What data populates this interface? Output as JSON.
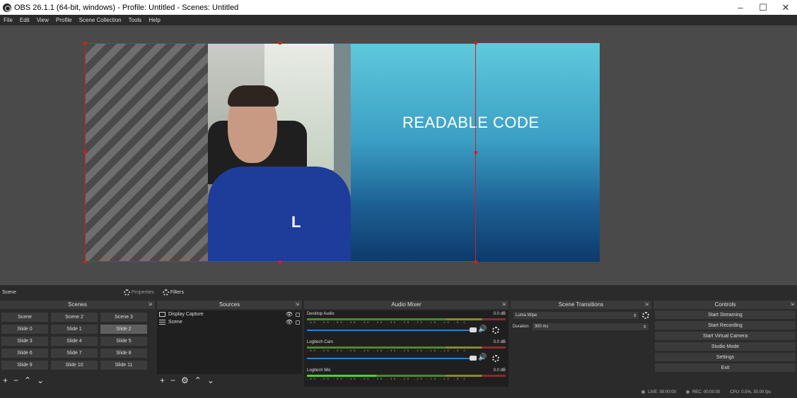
{
  "window": {
    "title": "OBS 26.1.1 (64-bit, windows) - Profile: Untitled - Scenes: Untitled",
    "minimize": "–",
    "maximize": "☐",
    "close": "✕"
  },
  "menu": [
    "File",
    "Edit",
    "View",
    "Profile",
    "Scene Collection",
    "Tools",
    "Help"
  ],
  "preview": {
    "slide_text": "READABLE CODE",
    "shirt_letter": "L"
  },
  "scenebar": {
    "current_scene": "Scene",
    "properties_label": "Properties",
    "filters_label": "Filters"
  },
  "scenes": {
    "header": "Scenes",
    "items": [
      "Scene",
      "Scene 2",
      "Scene 3",
      "Slide 0",
      "Slide 1",
      "Slide 2",
      "Slide 3",
      "Slide 4",
      "Slide 5",
      "Slide 6",
      "Slide 7",
      "Slide 8",
      "Slide 9",
      "Slide 10",
      "Slide 11"
    ],
    "selected": "Slide 2"
  },
  "sources": {
    "header": "Sources",
    "items": [
      {
        "name": "Display Capture",
        "icon": "monitor-icon"
      },
      {
        "name": "Scene",
        "icon": "list-icon"
      }
    ]
  },
  "mixer": {
    "header": "Audio Mixer",
    "channels": [
      {
        "name": "Desktop Audio",
        "level": "0.0 dB",
        "volume": 1.0
      },
      {
        "name": "Logitech Cam",
        "level": "0.0 dB",
        "volume": 1.0
      },
      {
        "name": "Logitech Mic",
        "level": "0.0 dB",
        "volume": 1.0
      }
    ],
    "ticks": "-60 -55 -50 -45 -40 -35 -30 -25 -20 -15 -10 -5 0"
  },
  "transitions": {
    "header": "Scene Transitions",
    "selected": "Luma Wipe",
    "duration_label": "Duration",
    "duration_value": "300 ms"
  },
  "controls": {
    "header": "Controls",
    "buttons": [
      "Start Streaming",
      "Start Recording",
      "Start Virtual Camera",
      "Studio Mode",
      "Settings",
      "Exit"
    ]
  },
  "status": {
    "live": "LIVE: 00:00:00",
    "rec": "REC: 00:00:00",
    "cpu": "CPU: 0.5%, 30.00 fps"
  },
  "colors": {
    "accent_selection": "#d02020",
    "volume_bar": "#2a82d0"
  }
}
